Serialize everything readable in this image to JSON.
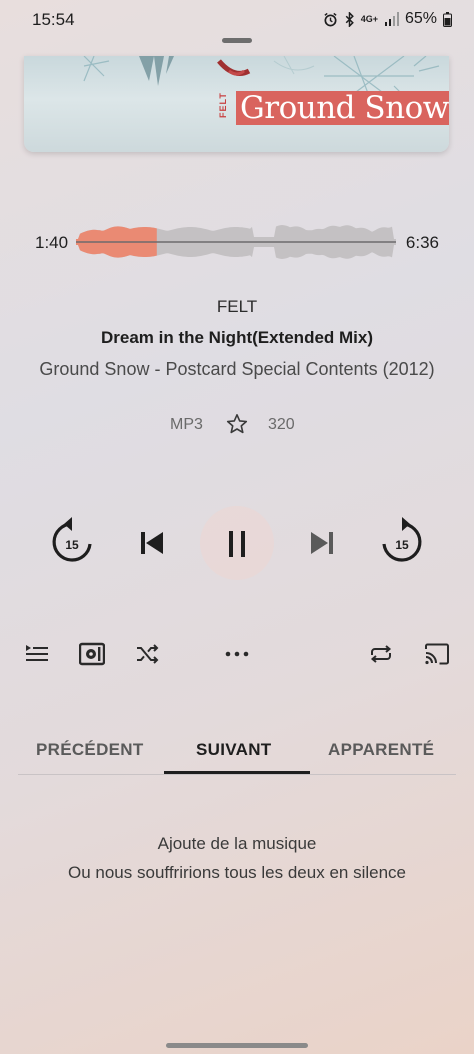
{
  "status_bar": {
    "time": "15:54",
    "network": "4G+",
    "battery": "65%"
  },
  "album_art": {
    "artist_text": "FELT",
    "title_text": "Ground Snow",
    "accent_color": "#d9645e"
  },
  "progress": {
    "elapsed": "1:40",
    "total": "6:36",
    "fraction": 0.2525,
    "played_color": "#ea8a73",
    "remaining_color": "#c4c1c3"
  },
  "track": {
    "artist": "FELT",
    "title": "Dream in the Night(Extended Mix)",
    "album": "Ground Snow - Postcard Special Contents (2012)",
    "format": "MP3",
    "bitrate": "320",
    "favorite_icon": "star-outline-icon"
  },
  "controls": {
    "rewind_seconds": "15",
    "forward_seconds": "15",
    "state": "playing"
  },
  "secondary_controls": [
    "queue-icon",
    "equalizer-icon",
    "shuffle-icon",
    "more-icon",
    "repeat-icon",
    "cast-icon"
  ],
  "tabs": [
    {
      "label": "PRÉCÉDENT",
      "active": false
    },
    {
      "label": "SUIVANT",
      "active": true
    },
    {
      "label": "APPARENTÉ",
      "active": false
    }
  ],
  "empty_state": {
    "line1": "Ajoute de la musique",
    "line2": "Ou nous souffririons tous les deux en silence"
  }
}
